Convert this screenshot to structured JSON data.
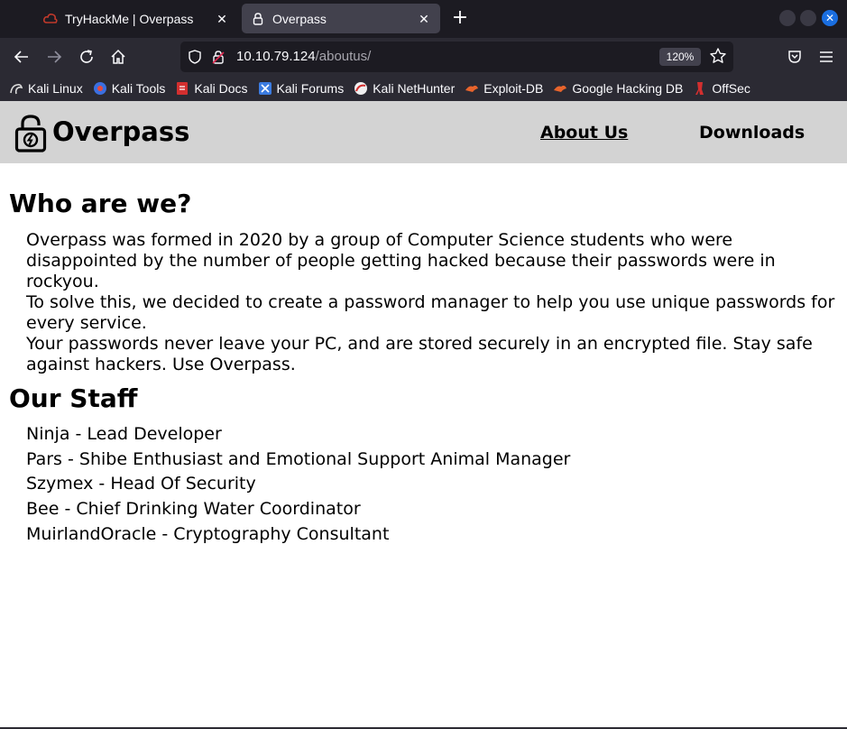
{
  "browser": {
    "tabs": [
      {
        "title": "TryHackMe | Overpass",
        "active": false,
        "icon": "tryhackme-cloud-icon"
      },
      {
        "title": "Overpass",
        "active": true,
        "icon": "lock-icon"
      }
    ],
    "new_tab": "+",
    "url": {
      "host": "10.10.79.124",
      "path": "/aboutus/"
    },
    "zoom": "120%",
    "bookmarks": [
      {
        "label": "Kali Linux",
        "icon": "kali-dragon-icon"
      },
      {
        "label": "Kali Tools",
        "icon": "kali-tools-icon"
      },
      {
        "label": "Kali Docs",
        "icon": "kali-docs-icon"
      },
      {
        "label": "Kali Forums",
        "icon": "kali-forums-icon"
      },
      {
        "label": "Kali NetHunter",
        "icon": "kali-nethunter-icon"
      },
      {
        "label": "Exploit-DB",
        "icon": "exploit-db-icon"
      },
      {
        "label": "Google Hacking DB",
        "icon": "ghdb-icon"
      },
      {
        "label": "OffSec",
        "icon": "offsec-icon"
      }
    ],
    "colors": {
      "chrome_dark": "#1c1b22",
      "toolbar": "#2b2a33",
      "active_tab": "#42414d",
      "close_accent": "#1a6ee0"
    }
  },
  "site": {
    "name": "Overpass",
    "nav": {
      "about": "About Us",
      "downloads": "Downloads"
    },
    "header_bg": "#d3d3d3"
  },
  "about": {
    "heading": "Who are we?",
    "paragraphs": [
      "Overpass was formed in 2020 by a group of Computer Science students who were disappointed by the number of people getting hacked because their passwords were in rockyou.",
      "To solve this, we decided to create a password manager to help you use unique passwords for every service.",
      "Your passwords never leave your PC, and are stored securely in an encrypted file. Stay safe against hackers. Use Overpass."
    ]
  },
  "staff": {
    "heading": "Our Staff",
    "members": [
      "Ninja - Lead Developer",
      "Pars - Shibe Enthusiast and Emotional Support Animal Manager",
      "Szymex - Head Of Security",
      "Bee - Chief Drinking Water Coordinator",
      "MuirlandOracle - Cryptography Consultant"
    ]
  }
}
